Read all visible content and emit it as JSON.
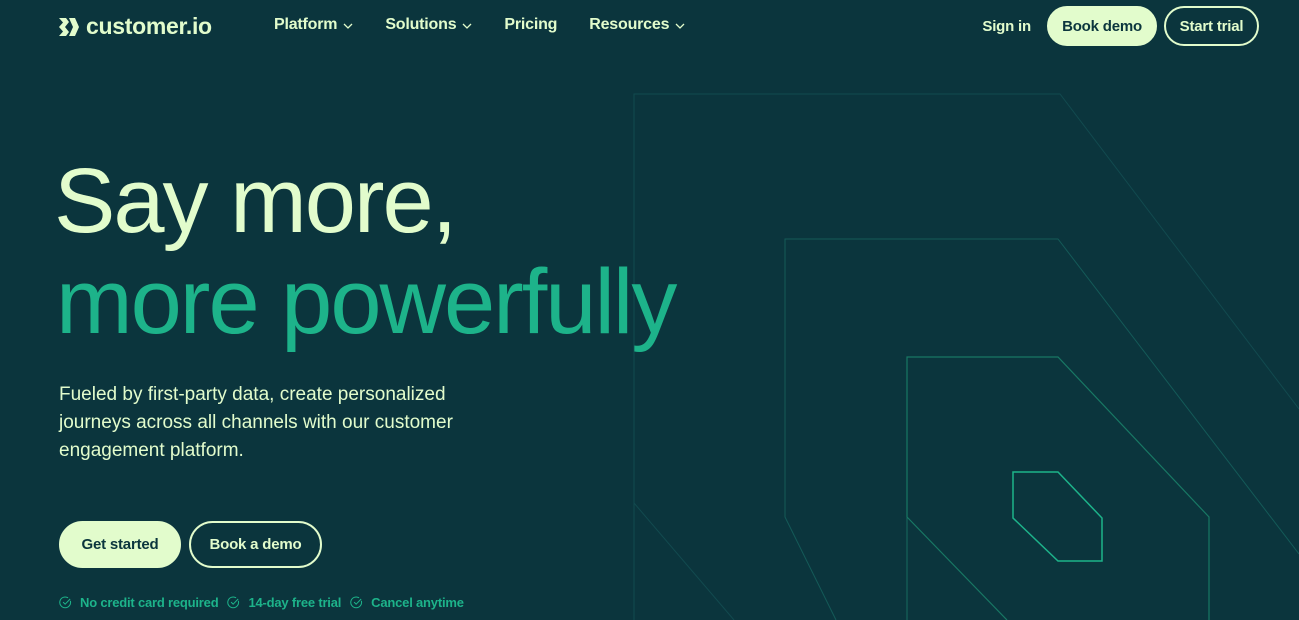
{
  "brand": {
    "name": "customer.io",
    "logo_icon": "chevron-diamond-logo-icon",
    "colors": {
      "background": "#0b353d",
      "cream": "#e2fccc",
      "accent_green": "#1db38a"
    }
  },
  "nav": {
    "items": [
      {
        "label": "Platform",
        "has_dropdown": true
      },
      {
        "label": "Solutions",
        "has_dropdown": true
      },
      {
        "label": "Pricing",
        "has_dropdown": false
      },
      {
        "label": "Resources",
        "has_dropdown": true
      }
    ],
    "sign_in": "Sign in",
    "book_demo": "Book demo",
    "start_trial": "Start trial"
  },
  "hero": {
    "title_line1": "Say more,",
    "title_line2": "more powerfully",
    "subtitle": "Fueled by first-party data, create personalized journeys across all channels with our customer engagement platform.",
    "primary_cta": "Get started",
    "secondary_cta": "Book a demo",
    "perks": [
      {
        "icon": "check-circle-icon",
        "label": "No credit card required"
      },
      {
        "icon": "check-circle-icon",
        "label": "14-day free trial"
      },
      {
        "icon": "check-circle-icon",
        "label": "Cancel anytime"
      }
    ]
  }
}
